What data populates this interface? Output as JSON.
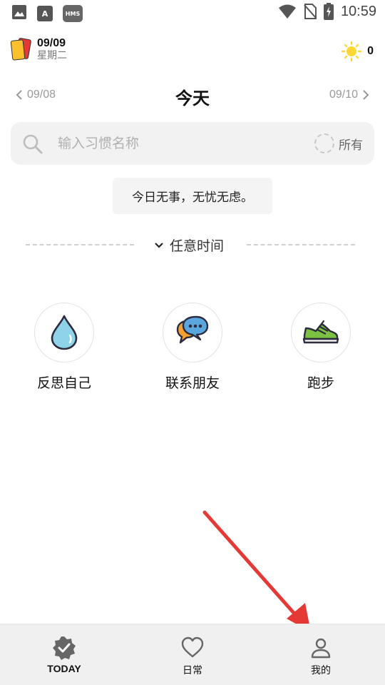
{
  "status_bar": {
    "left_icons": [
      "image-icon",
      "font-icon",
      "hms-icon"
    ],
    "a_glyph": "A",
    "hms_text": "HMS",
    "time": "10:59"
  },
  "header": {
    "date": "09/09",
    "weekday": "星期二",
    "sun_count": "0"
  },
  "day_nav": {
    "prev": "09/08",
    "title": "今天",
    "next": "09/10"
  },
  "search": {
    "placeholder": "输入习惯名称",
    "value": "",
    "filter_label": "所有"
  },
  "message": "今日无事，无忧无虑。",
  "section": {
    "label": "任意时间"
  },
  "habits": [
    {
      "label": "反思自己",
      "icon": "water-drop-icon"
    },
    {
      "label": "联系朋友",
      "icon": "chat-bubbles-icon"
    },
    {
      "label": "跑步",
      "icon": "sneaker-icon"
    }
  ],
  "bottom_nav": {
    "tabs": [
      {
        "label": "TODAY",
        "icon": "badge-check-icon",
        "active": true
      },
      {
        "label": "日常",
        "icon": "heart-icon",
        "active": false
      },
      {
        "label": "我的",
        "icon": "person-icon",
        "active": false
      }
    ]
  },
  "colors": {
    "arrow": "#e53935",
    "sun": "#fdd835",
    "card_red": "#e53935",
    "card_yellow": "#fbc02d"
  }
}
